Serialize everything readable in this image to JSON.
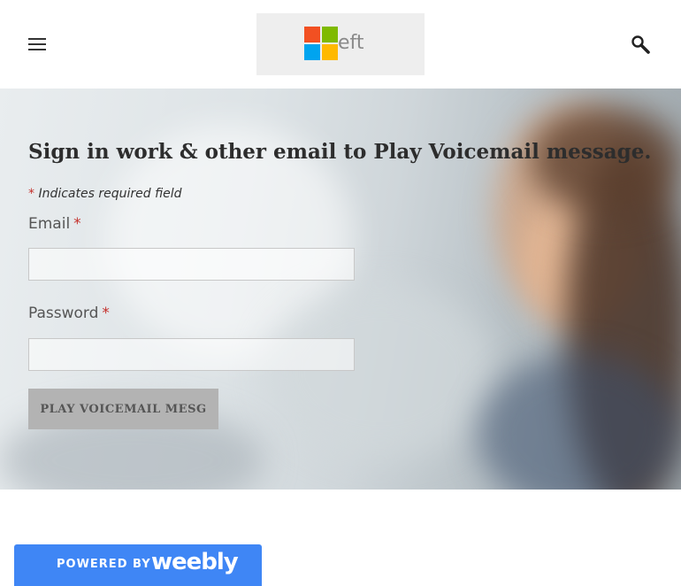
{
  "header": {
    "logo_text": "eft"
  },
  "colors": {
    "accent": "#3f86f5",
    "required": "#c4302b",
    "logo_red": "#f25022",
    "logo_green": "#7fba00",
    "logo_blue": "#00a4ef",
    "logo_yellow": "#ffb900"
  },
  "icons": {
    "menu": "hamburger-icon",
    "search": "search-icon"
  },
  "form": {
    "title": "Sign in work & other email to Play Voicemail message.",
    "required_note_star": "*",
    "required_note": "Indicates required field",
    "email_label": "Email",
    "email_required": "*",
    "email_value": "",
    "password_label": "Password",
    "password_required": "*",
    "password_value": "",
    "submit_label": "PLAY VOICEMAIL MESG"
  },
  "footer": {
    "powered_by": "POWERED BY",
    "brand": "weebly"
  }
}
